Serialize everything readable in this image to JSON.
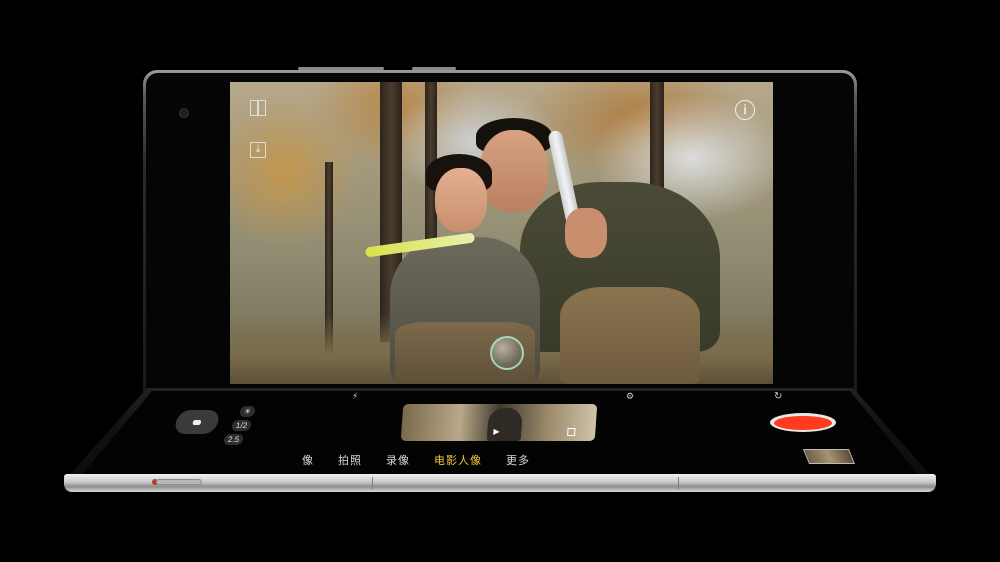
{
  "camera": {
    "modes": [
      "像",
      "拍照",
      "录像",
      "电影人像",
      "更多"
    ],
    "active_mode": "电影人像",
    "zoom_chips": [
      "☀",
      "1/2",
      "2.5"
    ],
    "icons": {
      "layout": "split-layout-icon",
      "save": "download-icon",
      "info": "info-icon",
      "info_glyph": "i",
      "flip": "camera-flip-icon",
      "flip_glyph": "↻",
      "play_glyph": "▶"
    }
  },
  "colors": {
    "record_button": "#ff3b1f",
    "active_mode": "#f4c542",
    "device_silver": "#c9c9c9"
  }
}
